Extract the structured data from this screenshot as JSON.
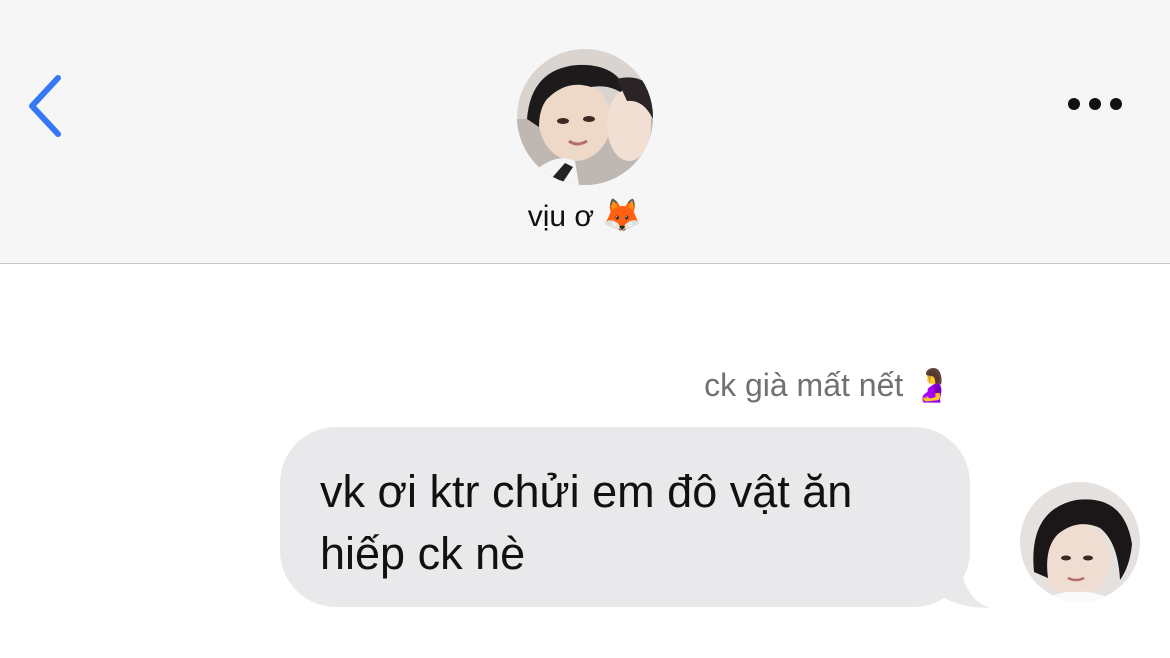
{
  "header": {
    "contact_name": "vịu ơ",
    "contact_emoji": "🦊",
    "back_icon": "chevron-left-icon",
    "more_icon": "ellipsis-icon",
    "accent_color": "#3478f6"
  },
  "messages": [
    {
      "sender_label": "ck già mất nết 🤰",
      "text": "vk ơi ktr chửi em đô vật ăn hiếp ck nè"
    }
  ],
  "colors": {
    "header_bg": "#f6f6f6",
    "bubble_bg": "#e9e9eb",
    "sender_label": "#707075"
  }
}
